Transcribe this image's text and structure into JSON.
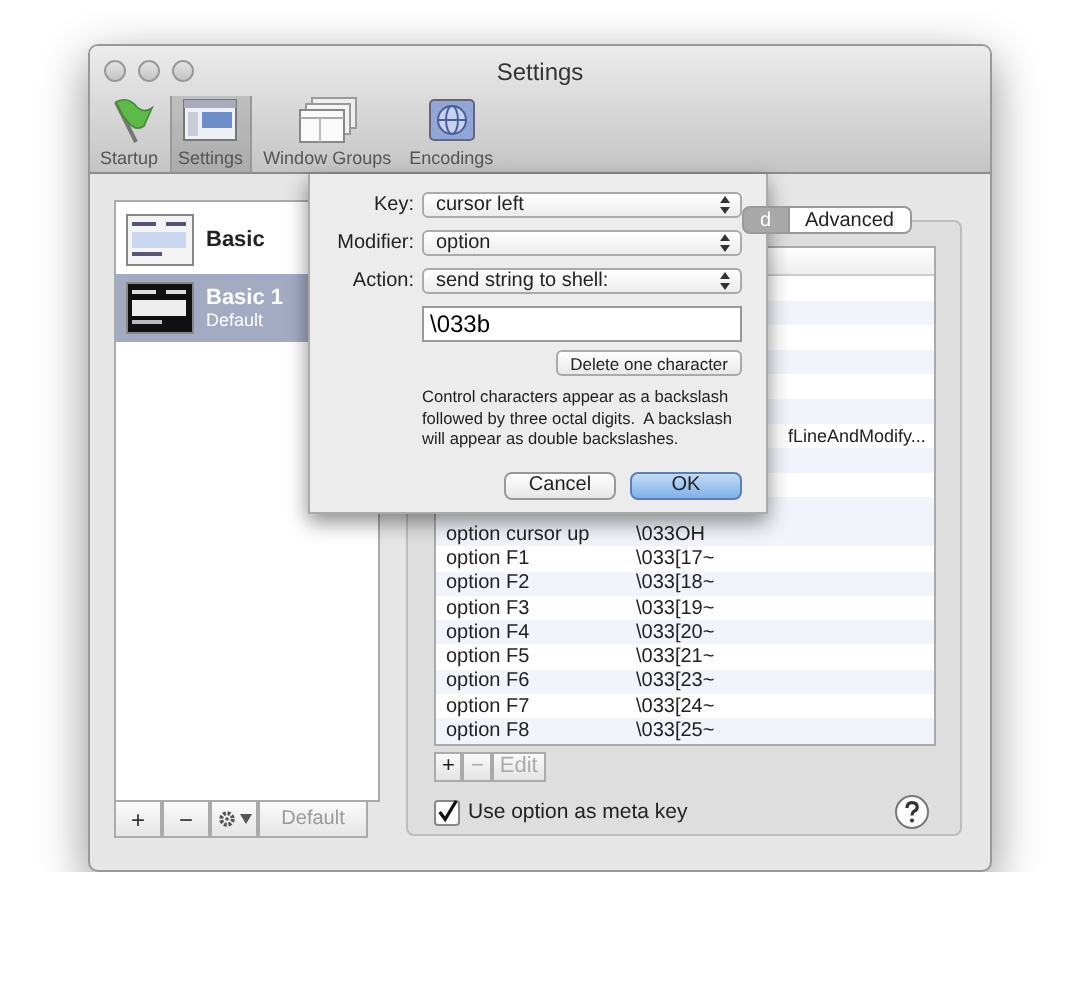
{
  "window": {
    "title": "Settings"
  },
  "toolbar": [
    {
      "label": "Startup",
      "kind": "flag",
      "selected": false
    },
    {
      "label": "Settings",
      "kind": "settings",
      "selected": true
    },
    {
      "label": "Window Groups",
      "kind": "windows",
      "selected": false
    },
    {
      "label": "Encodings",
      "kind": "globe",
      "selected": false
    }
  ],
  "profiles": {
    "items": [
      {
        "name": "Basic",
        "kind": "light",
        "selected": false
      },
      {
        "name": "Basic 1",
        "subtitle": "Default",
        "kind": "dark",
        "selected": true
      }
    ],
    "buttons": [
      {
        "kind": "add",
        "label": "+",
        "disabled": false
      },
      {
        "kind": "remove",
        "label": "−",
        "disabled": false
      },
      {
        "kind": "gear",
        "disabled": false
      },
      {
        "kind": "text",
        "label": "Default",
        "disabled": true
      }
    ]
  },
  "tabs": [
    {
      "label": "d",
      "selected": true
    },
    {
      "label": "Advanced",
      "selected": false
    }
  ],
  "keys_table": {
    "partial_text": "fLineAndModify...",
    "rows": [
      {
        "key": "option cursor up",
        "action": "\\033OH"
      },
      {
        "key": "option F1",
        "action": "\\033[17~"
      },
      {
        "key": "option F2",
        "action": "\\033[18~"
      },
      {
        "key": "option F3",
        "action": "\\033[19~"
      },
      {
        "key": "option F4",
        "action": "\\033[20~"
      },
      {
        "key": "option F5",
        "action": "\\033[21~"
      },
      {
        "key": "option F6",
        "action": "\\033[23~"
      },
      {
        "key": "option F7",
        "action": "\\033[24~"
      },
      {
        "key": "option F8",
        "action": "\\033[25~"
      }
    ]
  },
  "table_buttons": [
    {
      "label": "+",
      "disabled": false
    },
    {
      "label": "−",
      "disabled": true
    },
    {
      "label": "Edit",
      "disabled": true
    }
  ],
  "meta_key": {
    "label": "Use option as meta key",
    "checked": true
  },
  "sheet": {
    "fields": [
      {
        "label": "Key:",
        "value": "cursor left"
      },
      {
        "label": "Modifier:",
        "value": "option"
      },
      {
        "label": "Action:",
        "value": "send string to shell:"
      }
    ],
    "text_value": "\\033b",
    "delete_button": "Delete one character",
    "note": "Control characters appear as a backslash followed by three octal digits.  A backslash will appear as double backslashes.",
    "buttons": [
      {
        "label": "Cancel",
        "default": false
      },
      {
        "label": "OK",
        "default": true
      }
    ]
  }
}
